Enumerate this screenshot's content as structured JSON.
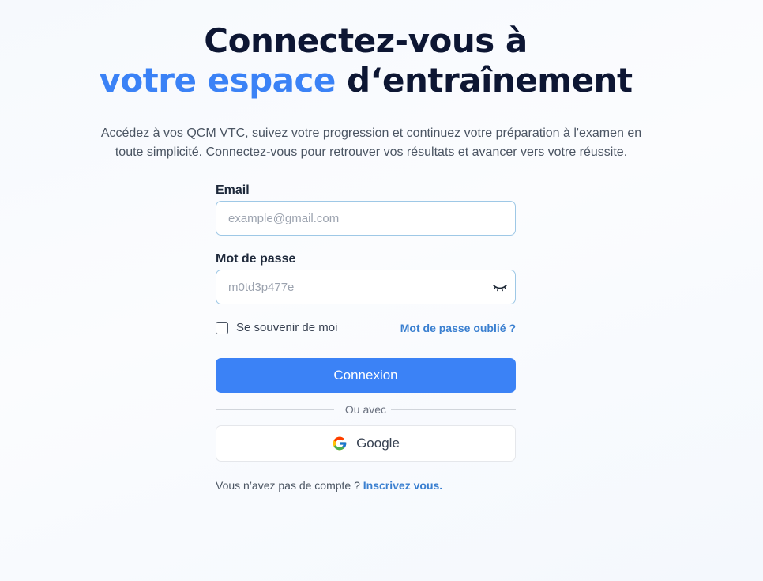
{
  "heading": {
    "line1": "Connectez-vous à",
    "line2_accent": "votre espace",
    "line2_rest": " d‘entraînement"
  },
  "intro": {
    "line1": "Accédez à vos QCM VTC, suivez votre progression et continuez votre préparation à l'examen en",
    "line2": "toute simplicité. Connectez-vous pour retrouver vos résultats et avancer vers votre réussite."
  },
  "form": {
    "email": {
      "label": "Email",
      "placeholder": "example@gmail.com",
      "value": ""
    },
    "password": {
      "label": "Mot de passe",
      "placeholder": "m0td3p477e",
      "value": "",
      "toggle_icon": "eye-closed-icon"
    },
    "remember": {
      "label": "Se souvenir de moi",
      "checked": false
    },
    "forgot_link": "Mot de passe oublié ?",
    "submit_label": "Connexion",
    "divider_text": "Ou avec",
    "google_label": "Google",
    "google_icon": "google-icon",
    "signup_prompt": "Vous n’avez pas de compte ? ",
    "signup_link": "Inscrivez vous."
  },
  "colors": {
    "accent": "#3b82f6",
    "link": "#3a7fd0",
    "heading": "#0d1633",
    "input_border": "#9ec8e6"
  }
}
